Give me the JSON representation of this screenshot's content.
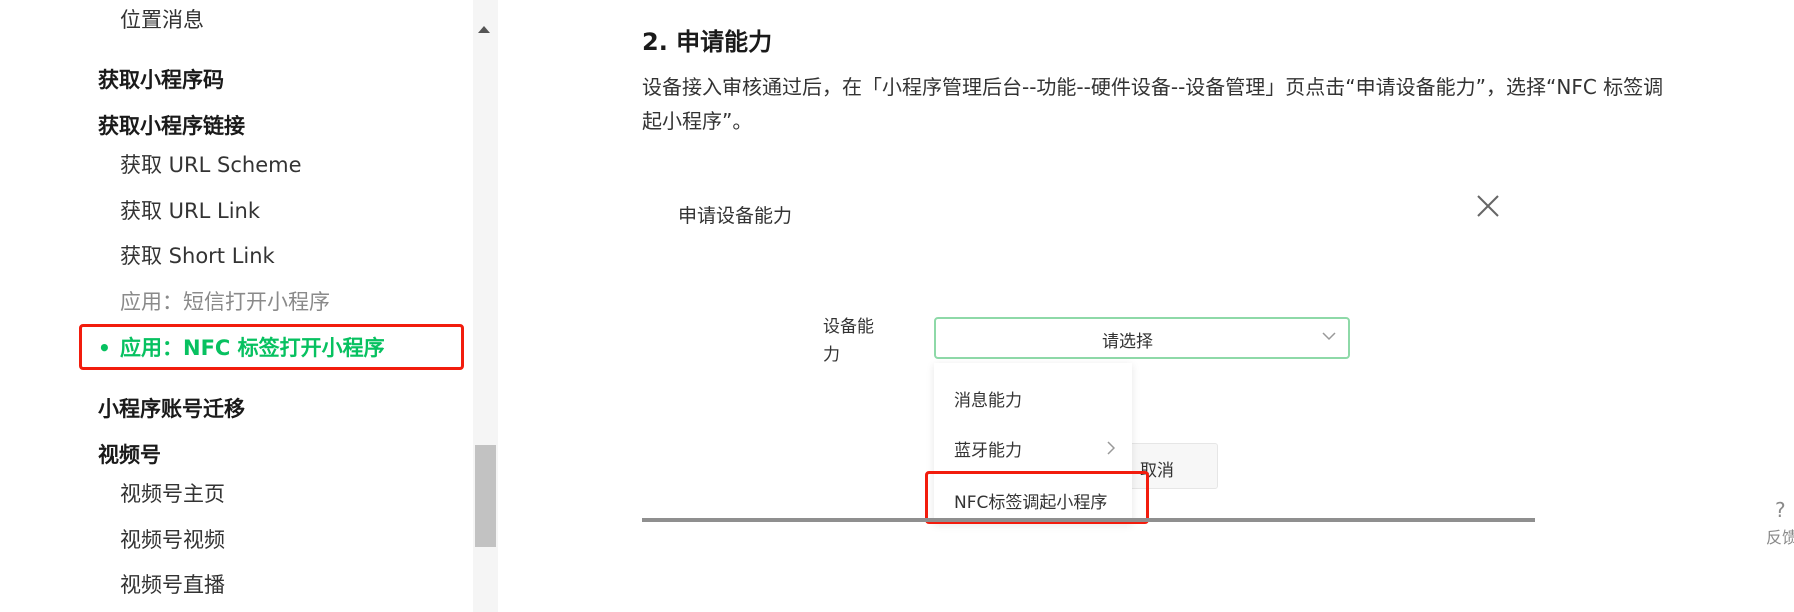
{
  "sidebar": {
    "top_partial": "位置消息",
    "items": [
      {
        "label": "获取小程序码"
      },
      {
        "label": "获取小程序链接"
      },
      {
        "label": "获取 URL Scheme"
      },
      {
        "label": "获取 URL Link"
      },
      {
        "label": "获取 Short Link"
      },
      {
        "label": "应用：短信打开小程序"
      },
      {
        "label": "应用：NFC 标签打开小程序",
        "bullet": "•"
      },
      {
        "label": "小程序账号迁移"
      },
      {
        "label": "视频号"
      },
      {
        "label": "视频号主页"
      },
      {
        "label": "视频号视频"
      },
      {
        "label": "视频号直播"
      }
    ],
    "active_color": "#07c160"
  },
  "content": {
    "heading": "2. 申请能力",
    "para_line1": "设备接入审核通过后，在「小程序管理后台--功能--硬件设备--设备管理」页点击“申请设备能力”，选择“NFC 标签调",
    "para_line2": "起小程序”。"
  },
  "dialog": {
    "title": "申请设备能力",
    "field_label_line1": "设备能",
    "field_label_line2": "力",
    "select_placeholder": "请选择",
    "options": [
      "消息能力",
      "蓝牙能力",
      "NFC标签调起小程序"
    ],
    "cancel_label": "取消"
  },
  "feedback": {
    "icon": "?",
    "label": "反馈"
  },
  "colors": {
    "highlight": "#f21c0d",
    "select_border": "#8ed9a8"
  }
}
